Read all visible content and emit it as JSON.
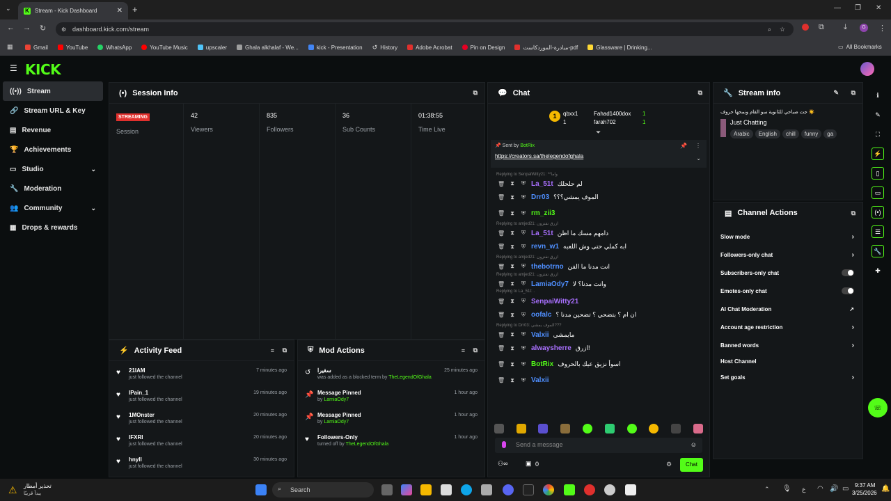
{
  "browser": {
    "tab_title": "Stream - Kick Dashboard",
    "url": "dashboard.kick.com/stream",
    "bookmarks": [
      "Gmail",
      "YouTube",
      "WhatsApp",
      "YouTube Music",
      "upscaler",
      "Ghala alkhalaf - We...",
      "kick - Presentation",
      "History",
      "Adobe Acrobat",
      "Pin on Design",
      "مبادرة-الموردكاست-pdf",
      "Glassware | Drinking..."
    ],
    "all_bookmarks": "All Bookmarks",
    "colors": {
      "accent": "#53fc18"
    }
  },
  "header": {
    "logo": "KICK"
  },
  "sidebar": {
    "items": [
      {
        "label": "Stream",
        "icon": "stream-icon",
        "active": true
      },
      {
        "label": "Stream URL & Key",
        "icon": "link-icon"
      },
      {
        "label": "Revenue",
        "icon": "revenue-icon"
      },
      {
        "label": "Achievements",
        "icon": "trophy-icon"
      },
      {
        "label": "Studio",
        "icon": "studio-icon",
        "expand": true
      },
      {
        "label": "Moderation",
        "icon": "wrench-icon"
      },
      {
        "label": "Community",
        "icon": "community-icon",
        "expand": true
      },
      {
        "label": "Drops & rewards",
        "icon": "drops-icon"
      }
    ]
  },
  "session": {
    "title": "Session Info",
    "status_badge": "STREAMING",
    "session_label": "Session",
    "viewers": "42",
    "viewers_label": "Viewers",
    "followers": "835",
    "followers_label": "Followers",
    "subs": "36",
    "subs_label": "Sub Counts",
    "time": "01:38:55",
    "time_label": "Time Live"
  },
  "activity": {
    "title": "Activity Feed",
    "items": [
      {
        "name": "21IAM",
        "action": "just followed the channel",
        "time": "7 minutes ago"
      },
      {
        "name": "IPain_1",
        "action": "just followed the channel",
        "time": "19 minutes ago"
      },
      {
        "name": "1MOnster",
        "action": "just followed the channel",
        "time": "20 minutes ago"
      },
      {
        "name": "IFXRI",
        "action": "just followed the channel",
        "time": "20 minutes ago"
      },
      {
        "name": "hnyII",
        "action": "just followed the channel",
        "time": "30 minutes ago"
      }
    ]
  },
  "mod": {
    "title": "Mod Actions",
    "items": [
      {
        "title": "سقيرا",
        "sub": "was added as a blocked term by",
        "by": "TheLegendOfGhala",
        "time": "25 minutes ago",
        "icon": "undo-icon"
      },
      {
        "title": "Message Pinned",
        "sub": "by",
        "by": "LamiaOdy7",
        "time": "1 hour ago",
        "icon": "pin-icon"
      },
      {
        "title": "Message Pinned",
        "sub": "by",
        "by": "LamiaOdy7",
        "time": "1 hour ago",
        "icon": "pin-icon"
      },
      {
        "title": "Followers-Only",
        "sub": "turned off by",
        "by": "TheLegendOfGhala",
        "time": "1 hour ago",
        "icon": "heart-icon"
      }
    ]
  },
  "chat": {
    "title": "Chat",
    "top_gifters": [
      {
        "name": "qbxx1",
        "count": "1"
      },
      {
        "name": "Fahad1400dox",
        "count": "1"
      },
      {
        "name": "farah702",
        "count": "1"
      }
    ],
    "pinned": {
      "sent_by": "Sent by",
      "sender": "BotRix",
      "link": "https://creators.sa/thelegendofghala"
    },
    "messages": [
      {
        "reply": "Replying to SenpaiWitty21: **واما",
        "user": "La_51t",
        "color": "#a970ff",
        "text": "لم حلحلك"
      },
      {
        "reply": "",
        "user": "Drr03",
        "color": "#4f8fff",
        "text": "الموف يمشي؟؟؟"
      },
      {
        "reply": "",
        "user": "rm_zii3",
        "color": "#53fc18",
        "text": ""
      },
      {
        "reply": "Replying to amjed21: ازرق تفتزون",
        "user": "La_51t",
        "color": "#a970ff",
        "text": "دامهم مسك ما اظن"
      },
      {
        "reply": "",
        "user": "revn_w1",
        "color": "#4f8fff",
        "text": "ابه كملي حتى وش اللعبه"
      },
      {
        "reply": "Replying to amjed21: ازرق تفتزون",
        "user": "thebotrno",
        "color": "#4f8fff",
        "text": "انت مدنا ما الفن"
      },
      {
        "reply": "Replying to amjed21: ازرق تفتزون",
        "user": "LamiaOdy7",
        "color": "#4f8fff",
        "text": "وانت مدنا؟ لا"
      },
      {
        "reply": "Replying to La_51t: .",
        "user": "SenpaiWitty21",
        "color": "#a970ff",
        "text": ""
      },
      {
        "reply": "",
        "user": "oofalc",
        "color": "#4f8fff",
        "text": "ان ام ؟ بتضحي ؟ تضحين مدنا ؟"
      },
      {
        "reply": "Replying to Drr03: الموف يمشي???",
        "user": "Valxii",
        "color": "#4f8fff",
        "text": "مايمشي"
      },
      {
        "reply": "",
        "user": "alwaysherre",
        "color": "#a970ff",
        "text": "ازرق!"
      },
      {
        "reply": "",
        "user": "BotRix",
        "color": "#53fc18",
        "text": "اسوأ نزيق عيك بالحروف"
      },
      {
        "reply": "",
        "user": "Valxii",
        "color": "#4f8fff",
        "text": ""
      }
    ],
    "input_placeholder": "Send a message",
    "count": "0",
    "send_label": "Chat"
  },
  "stream_info": {
    "title": "Stream info",
    "stream_title": "☀️ جت صباحي للثانوية سو القام ونمحها حروف",
    "category": "Just Chatting",
    "tags": [
      "Arabic",
      "English",
      "chill",
      "funny",
      "ga"
    ]
  },
  "channel_actions": {
    "title": "Channel Actions",
    "items": [
      {
        "label": "Slow mode",
        "kind": "arrow"
      },
      {
        "label": "Followers-only chat",
        "kind": "arrow"
      },
      {
        "label": "Subscribers-only chat",
        "kind": "toggle"
      },
      {
        "label": "Emotes-only chat",
        "kind": "toggle"
      },
      {
        "label": "AI Chat Moderation",
        "kind": "ext"
      },
      {
        "label": "Account age restriction",
        "kind": "arrow"
      },
      {
        "label": "Banned words",
        "kind": "arrow"
      },
      {
        "label": "Host Channel",
        "kind": "none"
      },
      {
        "label": "Set goals",
        "kind": "arrow"
      }
    ]
  },
  "taskbar": {
    "weather": "تحذير أمطار",
    "weather_sub": "يبدأ قريبًا",
    "search": "Search",
    "lang": "ع",
    "time": "9:37 AM",
    "date": "3/25/2026"
  }
}
